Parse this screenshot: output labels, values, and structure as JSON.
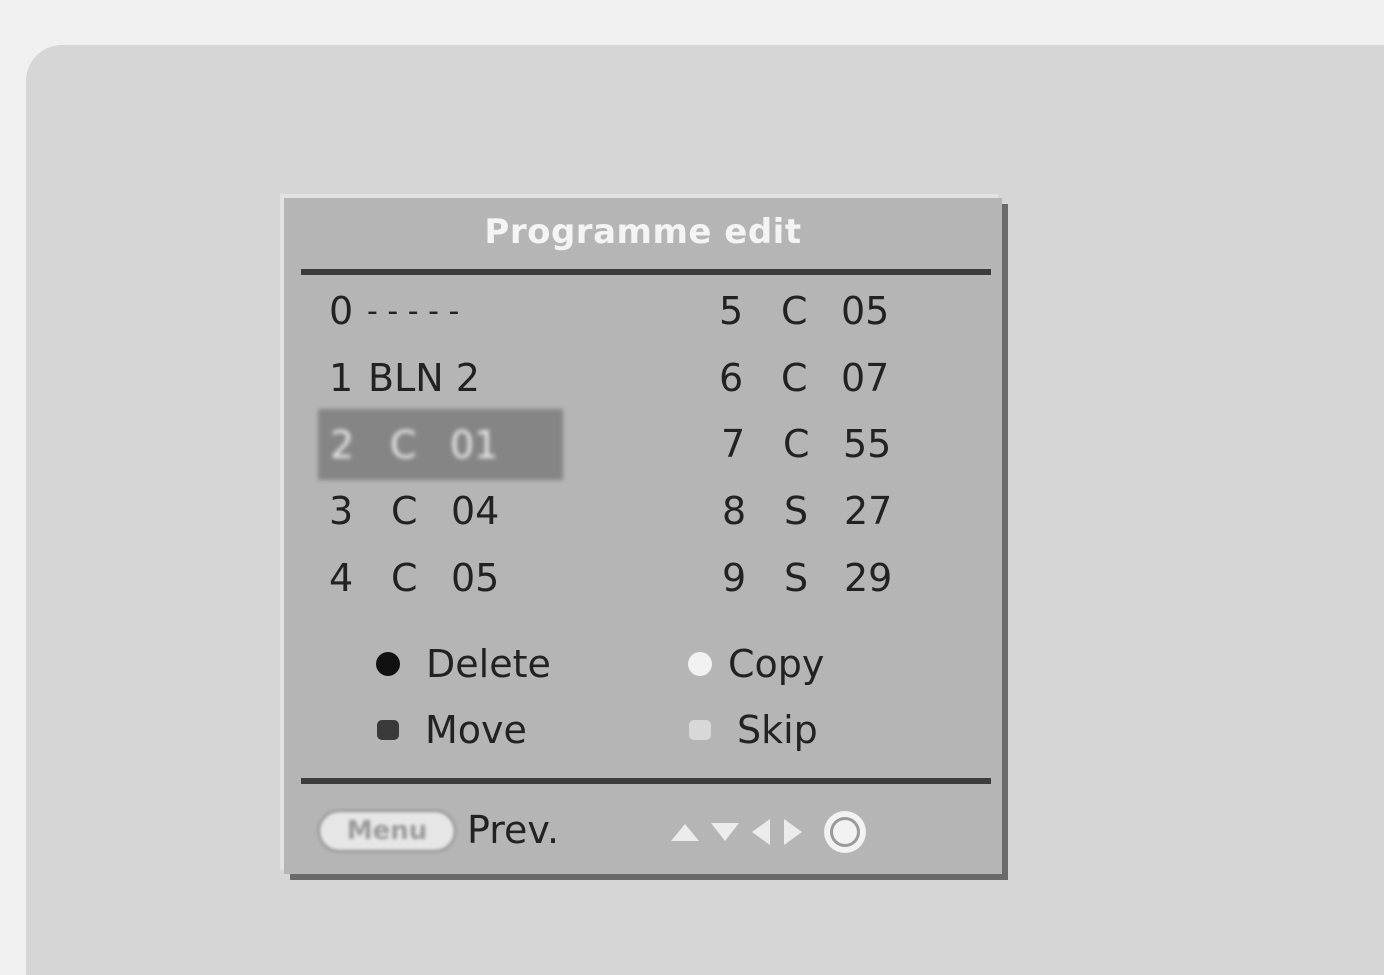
{
  "window": {
    "title": "Programme edit"
  },
  "programmes": {
    "left": [
      {
        "num": "0",
        "sys": "",
        "ch": "",
        "name": "- - - - -"
      },
      {
        "num": "1",
        "sys": "",
        "ch": "",
        "name": "BLN 2"
      },
      {
        "num": "2",
        "sys": "C",
        "ch": "01",
        "name": "",
        "selected": true
      },
      {
        "num": "3",
        "sys": "C",
        "ch": "04",
        "name": ""
      },
      {
        "num": "4",
        "sys": "C",
        "ch": "05",
        "name": ""
      }
    ],
    "right": [
      {
        "num": "5",
        "sys": "C",
        "ch": "05"
      },
      {
        "num": "6",
        "sys": "C",
        "ch": "07"
      },
      {
        "num": "7",
        "sys": "C",
        "ch": "55"
      },
      {
        "num": "8",
        "sys": "S",
        "ch": "27"
      },
      {
        "num": "9",
        "sys": "S",
        "ch": "29"
      }
    ]
  },
  "legend": {
    "delete": {
      "label": "Delete",
      "color": "#111111",
      "icon": "red-button-icon"
    },
    "copy": {
      "label": "Copy",
      "color": "#f2f2f2",
      "icon": "green-button-icon"
    },
    "move": {
      "label": "Move",
      "color": "#3a3a3a",
      "icon": "yellow-button-icon"
    },
    "skip": {
      "label": "Skip",
      "color": "#d8d8d8",
      "icon": "blue-button-icon"
    }
  },
  "footer": {
    "menu_key": "Menu",
    "prev_label": "Prev.",
    "nav_icons": [
      "up-arrow-icon",
      "down-arrow-icon",
      "left-arrow-icon",
      "right-arrow-icon",
      "ok-icon"
    ]
  },
  "colors": {
    "panel": "#b5b5b5",
    "highlight": "#858585",
    "title_text": "#f4f4f4"
  }
}
